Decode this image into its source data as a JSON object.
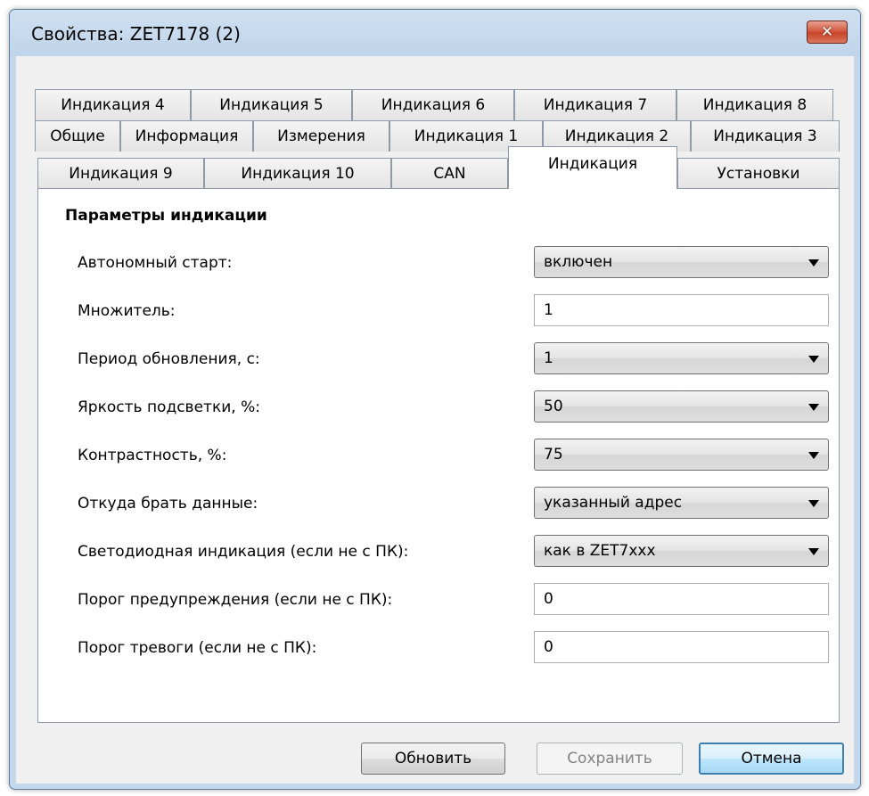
{
  "window": {
    "title": "Свойства: ZET7178 (2)",
    "close_glyph": "✕"
  },
  "tabs": {
    "row1": [
      "Индикация 4",
      "Индикация 5",
      "Индикация 6",
      "Индикация 7",
      "Индикация 8"
    ],
    "row2": [
      "Общие",
      "Информация",
      "Измерения",
      "Индикация 1",
      "Индикация 2",
      "Индикация 3"
    ],
    "row3": [
      "Индикация 9",
      "Индикация 10",
      "CAN",
      "Индикация",
      "Установки"
    ],
    "active": "Индикация"
  },
  "panel": {
    "section_title": "Параметры индикации",
    "fields": [
      {
        "label": "Автономный старт:",
        "type": "combo",
        "value": "включен"
      },
      {
        "label": "Множитель:",
        "type": "text",
        "value": "1"
      },
      {
        "label": "Период обновления, с:",
        "type": "combo",
        "value": "1"
      },
      {
        "label": "Яркость подсветки, %:",
        "type": "combo",
        "value": "50"
      },
      {
        "label": "Контрастность, %:",
        "type": "combo",
        "value": "75"
      },
      {
        "label": "Откуда брать данные:",
        "type": "combo",
        "value": "указанный адрес"
      },
      {
        "label": "Светодиодная индикация (если не с ПК):",
        "type": "combo",
        "value": "как в ZET7xxx"
      },
      {
        "label": "Порог предупреждения (если не с ПК):",
        "type": "text",
        "value": "0"
      },
      {
        "label": "Порог тревоги (если не с ПК):",
        "type": "text",
        "value": "0"
      }
    ]
  },
  "buttons": {
    "refresh": "Обновить",
    "save": "Сохранить",
    "cancel": "Отмена"
  }
}
